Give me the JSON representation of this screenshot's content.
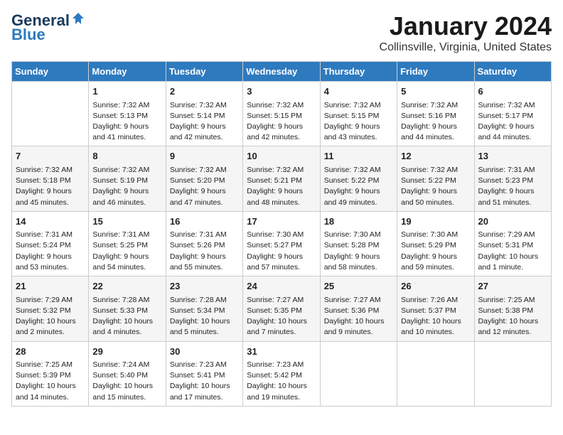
{
  "header": {
    "logo_general": "General",
    "logo_blue": "Blue",
    "month_title": "January 2024",
    "location": "Collinsville, Virginia, United States"
  },
  "days_of_week": [
    "Sunday",
    "Monday",
    "Tuesday",
    "Wednesday",
    "Thursday",
    "Friday",
    "Saturday"
  ],
  "weeks": [
    [
      {
        "day": null,
        "info": null
      },
      {
        "day": "1",
        "sunrise": "7:32 AM",
        "sunset": "5:13 PM",
        "daylight": "9 hours and 41 minutes."
      },
      {
        "day": "2",
        "sunrise": "7:32 AM",
        "sunset": "5:14 PM",
        "daylight": "9 hours and 42 minutes."
      },
      {
        "day": "3",
        "sunrise": "7:32 AM",
        "sunset": "5:15 PM",
        "daylight": "9 hours and 42 minutes."
      },
      {
        "day": "4",
        "sunrise": "7:32 AM",
        "sunset": "5:15 PM",
        "daylight": "9 hours and 43 minutes."
      },
      {
        "day": "5",
        "sunrise": "7:32 AM",
        "sunset": "5:16 PM",
        "daylight": "9 hours and 44 minutes."
      },
      {
        "day": "6",
        "sunrise": "7:32 AM",
        "sunset": "5:17 PM",
        "daylight": "9 hours and 44 minutes."
      }
    ],
    [
      {
        "day": "7",
        "sunrise": "7:32 AM",
        "sunset": "5:18 PM",
        "daylight": "9 hours and 45 minutes."
      },
      {
        "day": "8",
        "sunrise": "7:32 AM",
        "sunset": "5:19 PM",
        "daylight": "9 hours and 46 minutes."
      },
      {
        "day": "9",
        "sunrise": "7:32 AM",
        "sunset": "5:20 PM",
        "daylight": "9 hours and 47 minutes."
      },
      {
        "day": "10",
        "sunrise": "7:32 AM",
        "sunset": "5:21 PM",
        "daylight": "9 hours and 48 minutes."
      },
      {
        "day": "11",
        "sunrise": "7:32 AM",
        "sunset": "5:22 PM",
        "daylight": "9 hours and 49 minutes."
      },
      {
        "day": "12",
        "sunrise": "7:32 AM",
        "sunset": "5:22 PM",
        "daylight": "9 hours and 50 minutes."
      },
      {
        "day": "13",
        "sunrise": "7:31 AM",
        "sunset": "5:23 PM",
        "daylight": "9 hours and 51 minutes."
      }
    ],
    [
      {
        "day": "14",
        "sunrise": "7:31 AM",
        "sunset": "5:24 PM",
        "daylight": "9 hours and 53 minutes."
      },
      {
        "day": "15",
        "sunrise": "7:31 AM",
        "sunset": "5:25 PM",
        "daylight": "9 hours and 54 minutes."
      },
      {
        "day": "16",
        "sunrise": "7:31 AM",
        "sunset": "5:26 PM",
        "daylight": "9 hours and 55 minutes."
      },
      {
        "day": "17",
        "sunrise": "7:30 AM",
        "sunset": "5:27 PM",
        "daylight": "9 hours and 57 minutes."
      },
      {
        "day": "18",
        "sunrise": "7:30 AM",
        "sunset": "5:28 PM",
        "daylight": "9 hours and 58 minutes."
      },
      {
        "day": "19",
        "sunrise": "7:30 AM",
        "sunset": "5:29 PM",
        "daylight": "9 hours and 59 minutes."
      },
      {
        "day": "20",
        "sunrise": "7:29 AM",
        "sunset": "5:31 PM",
        "daylight": "10 hours and 1 minute."
      }
    ],
    [
      {
        "day": "21",
        "sunrise": "7:29 AM",
        "sunset": "5:32 PM",
        "daylight": "10 hours and 2 minutes."
      },
      {
        "day": "22",
        "sunrise": "7:28 AM",
        "sunset": "5:33 PM",
        "daylight": "10 hours and 4 minutes."
      },
      {
        "day": "23",
        "sunrise": "7:28 AM",
        "sunset": "5:34 PM",
        "daylight": "10 hours and 5 minutes."
      },
      {
        "day": "24",
        "sunrise": "7:27 AM",
        "sunset": "5:35 PM",
        "daylight": "10 hours and 7 minutes."
      },
      {
        "day": "25",
        "sunrise": "7:27 AM",
        "sunset": "5:36 PM",
        "daylight": "10 hours and 9 minutes."
      },
      {
        "day": "26",
        "sunrise": "7:26 AM",
        "sunset": "5:37 PM",
        "daylight": "10 hours and 10 minutes."
      },
      {
        "day": "27",
        "sunrise": "7:25 AM",
        "sunset": "5:38 PM",
        "daylight": "10 hours and 12 minutes."
      }
    ],
    [
      {
        "day": "28",
        "sunrise": "7:25 AM",
        "sunset": "5:39 PM",
        "daylight": "10 hours and 14 minutes."
      },
      {
        "day": "29",
        "sunrise": "7:24 AM",
        "sunset": "5:40 PM",
        "daylight": "10 hours and 15 minutes."
      },
      {
        "day": "30",
        "sunrise": "7:23 AM",
        "sunset": "5:41 PM",
        "daylight": "10 hours and 17 minutes."
      },
      {
        "day": "31",
        "sunrise": "7:23 AM",
        "sunset": "5:42 PM",
        "daylight": "10 hours and 19 minutes."
      },
      {
        "day": null,
        "info": null
      },
      {
        "day": null,
        "info": null
      },
      {
        "day": null,
        "info": null
      }
    ]
  ]
}
